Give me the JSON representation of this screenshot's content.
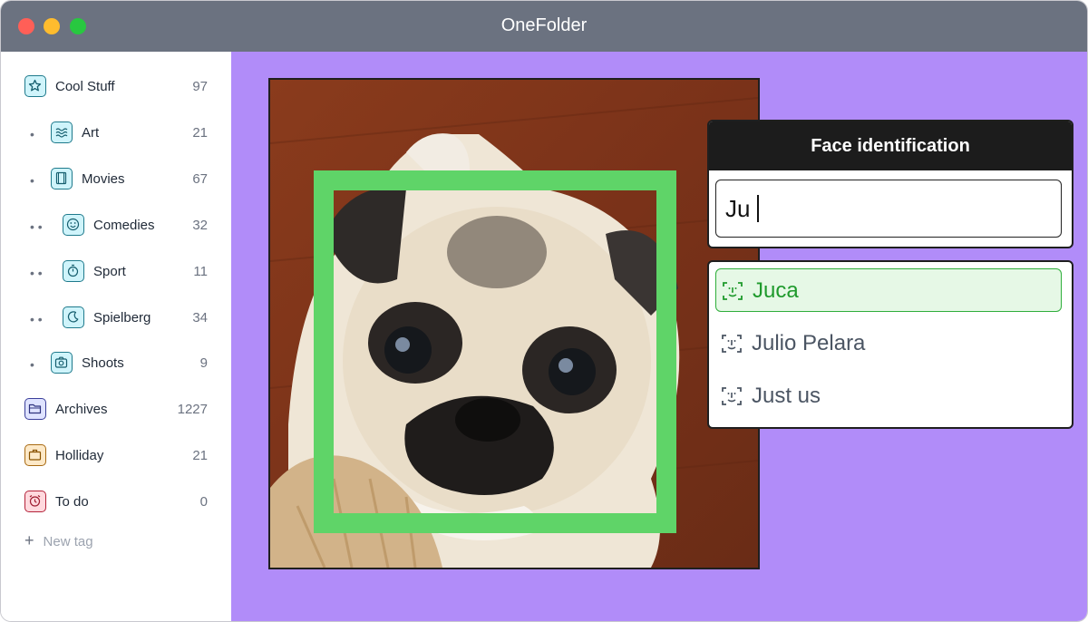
{
  "app": {
    "title": "OneFolder"
  },
  "sidebar": {
    "tags": [
      {
        "label": "Cool Stuff",
        "count": "97",
        "depth": 0,
        "icon": "star-icon",
        "color": "cyan"
      },
      {
        "label": "Art",
        "count": "21",
        "depth": 1,
        "icon": "waves-icon",
        "color": "cyan"
      },
      {
        "label": "Movies",
        "count": "67",
        "depth": 1,
        "icon": "film-icon",
        "color": "cyan"
      },
      {
        "label": "Comedies",
        "count": "32",
        "depth": 2,
        "icon": "smiley-icon",
        "color": "cyan"
      },
      {
        "label": "Sport",
        "count": "11",
        "depth": 2,
        "icon": "stopwatch-icon",
        "color": "cyan"
      },
      {
        "label": "Spielberg",
        "count": "34",
        "depth": 2,
        "icon": "moon-icon",
        "color": "cyan"
      },
      {
        "label": "Shoots",
        "count": "9",
        "depth": 1,
        "icon": "camera-icon",
        "color": "cyan"
      },
      {
        "label": "Archives",
        "count": "1227",
        "depth": 0,
        "icon": "folder-icon",
        "color": "indigo"
      },
      {
        "label": "Holliday",
        "count": "21",
        "depth": 0,
        "icon": "briefcase-icon",
        "color": "amber"
      },
      {
        "label": "To do",
        "count": "0",
        "depth": 0,
        "icon": "alarm-icon",
        "color": "rose"
      }
    ],
    "new_tag_label": "New tag"
  },
  "face_panel": {
    "title": "Face identification",
    "input_value": "Ju",
    "suggestions": [
      {
        "label": "Juca",
        "selected": true
      },
      {
        "label": "Julio Pelara",
        "selected": false
      },
      {
        "label": "Just us",
        "selected": false
      }
    ]
  },
  "colors": {
    "titlebar": "#6b7280",
    "canvas": "#b18cf9",
    "face_box": "#5fd468",
    "selected_suggestion": "#1f9a2c"
  }
}
